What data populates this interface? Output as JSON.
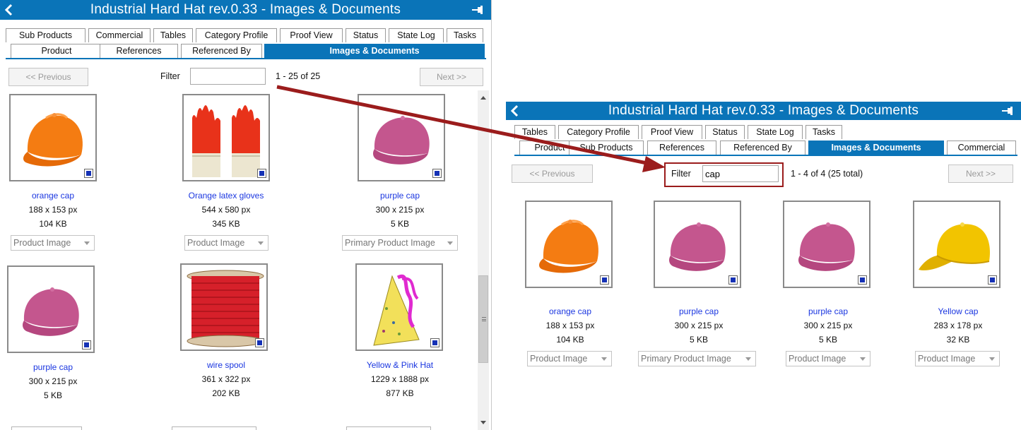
{
  "left_panel": {
    "title": "Industrial Hard Hat rev.0.33 - Images & Documents",
    "tabs_row1": [
      "Sub Products",
      "Commercial",
      "Tables",
      "Category Profile",
      "Proof View",
      "Status",
      "State Log",
      "Tasks"
    ],
    "tabs_row2": [
      "Product",
      "References",
      "Referenced By",
      "Images & Documents"
    ],
    "active_tab": "Images & Documents",
    "prev_label": "<< Previous",
    "next_label": "Next >>",
    "filter_label": "Filter",
    "filter_value": "",
    "range_text": "1 - 25 of 25",
    "items": [
      {
        "name": "orange cap",
        "dims": "188 x 153 px",
        "size": "104 KB",
        "type": "Product Image"
      },
      {
        "name": "Orange latex gloves",
        "dims": "544 x 580 px",
        "size": "345 KB",
        "type": "Product Image"
      },
      {
        "name": "purple cap",
        "dims": "300 x 215 px",
        "size": "5 KB",
        "type": "Primary Product Image"
      },
      {
        "name": "purple cap",
        "dims": "300 x 215 px",
        "size": "5 KB",
        "type": ""
      },
      {
        "name": "wire spool",
        "dims": "361 x 322 px",
        "size": "202 KB",
        "type": ""
      },
      {
        "name": "Yellow & Pink Hat",
        "dims": "1229 x 1888 px",
        "size": "877 KB",
        "type": ""
      }
    ]
  },
  "right_panel": {
    "title": "Industrial Hard Hat rev.0.33 - Images & Documents",
    "tabs_row1": [
      "Tables",
      "Category Profile",
      "Proof View",
      "Status",
      "State Log",
      "Tasks"
    ],
    "tabs_row2": [
      "Product",
      "Sub Products",
      "References",
      "Referenced By",
      "Images & Documents",
      "Commercial"
    ],
    "active_tab": "Images & Documents",
    "prev_label": "<< Previous",
    "next_label": "Next >>",
    "filter_label": "Filter",
    "filter_value": "cap",
    "range_text": "1 - 4 of 4 (25 total)",
    "items": [
      {
        "name": "orange cap",
        "dims": "188 x 153 px",
        "size": "104 KB",
        "type": "Product Image"
      },
      {
        "name": "purple cap",
        "dims": "300 x 215 px",
        "size": "5 KB",
        "type": "Primary Product Image"
      },
      {
        "name": "purple cap",
        "dims": "300 x 215 px",
        "size": "5 KB",
        "type": "Product Image"
      },
      {
        "name": "Yellow cap",
        "dims": "283 x 178 px",
        "size": "32 KB",
        "type": "Product Image"
      }
    ]
  },
  "icons": {
    "back": "chevron-left-icon",
    "pin": "pin-icon",
    "badge": "document-badge-icon",
    "dropdown": "chevron-down-icon"
  },
  "colors": {
    "titlebar": "#0a74b8",
    "link": "#1a36e0",
    "annotation": "#9b1c1c"
  }
}
